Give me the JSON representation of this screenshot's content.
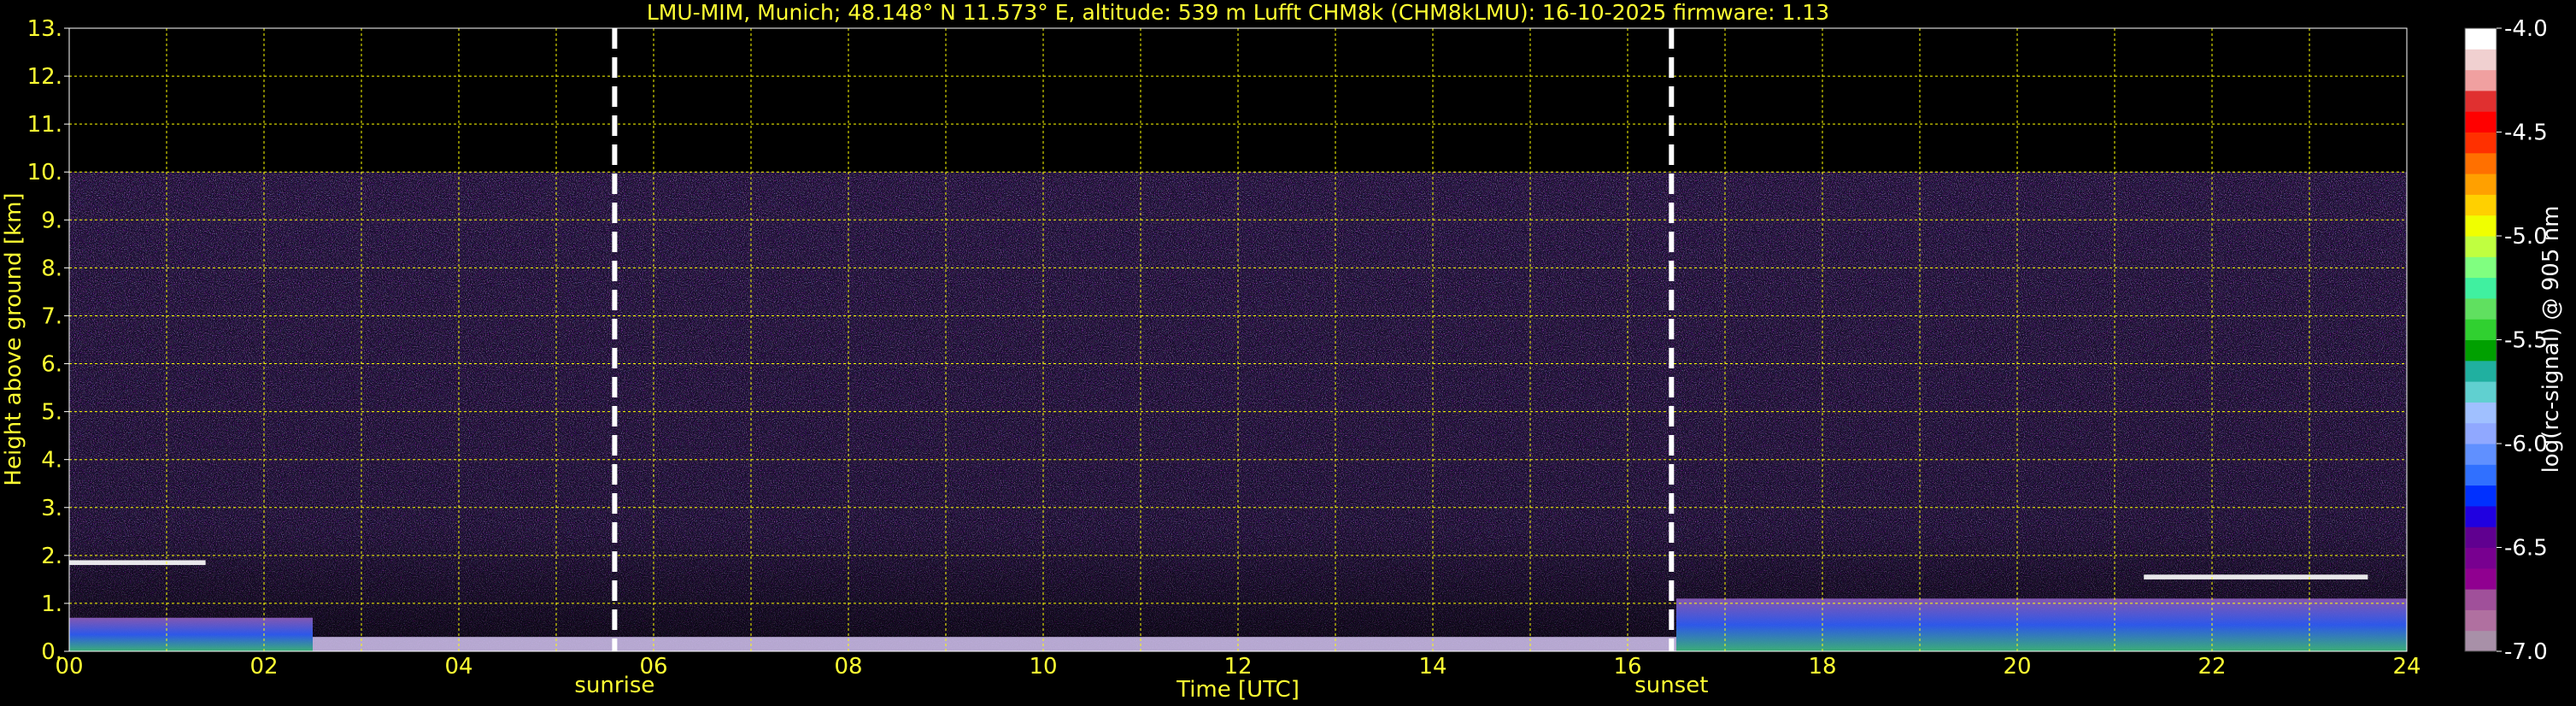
{
  "chart_data": {
    "type": "heatmap",
    "title": "LMU-MIM, Munich; 48.148° N 11.573° E, altitude: 539 m    Lufft CHM8k (CHM8kLMU): 16-10-2025    firmware: 1.13",
    "xlabel": "Time [UTC]",
    "ylabel": "Height above ground [km]",
    "xlim": [
      0,
      24
    ],
    "ylim": [
      0,
      13
    ],
    "x_ticks": [
      "00",
      "02",
      "04",
      "06",
      "08",
      "10",
      "12",
      "14",
      "16",
      "18",
      "20",
      "22",
      "24"
    ],
    "y_ticks": [
      "0.",
      "1.",
      "2.",
      "3.",
      "4.",
      "5.",
      "6.",
      "7.",
      "8.",
      "9.",
      "10.",
      "11.",
      "12.",
      "13."
    ],
    "grid": true,
    "grid_color": "#ffff00",
    "events": [
      {
        "name": "sunrise",
        "time": 5.6
      },
      {
        "name": "sunset",
        "time": 16.45
      }
    ],
    "colorbar": {
      "label": "log(rc-signal) @ 905 nm",
      "range": [
        -7.0,
        -4.0
      ],
      "ticks": [
        "-4.0",
        "-4.5",
        "-5.0",
        "-5.5",
        "-6.0",
        "-6.5",
        "-7.0"
      ],
      "colors": [
        "#a890a8",
        "#b070a0",
        "#a0509a",
        "#900090",
        "#780090",
        "#600090",
        "#2000e0",
        "#0030ff",
        "#3070ff",
        "#6090ff",
        "#90a8ff",
        "#a0c0ff",
        "#60d0d0",
        "#20b0a0",
        "#00a000",
        "#30d030",
        "#60e060",
        "#40f0a0",
        "#80ff80",
        "#c0ff40",
        "#f0ff00",
        "#ffd000",
        "#ffa000",
        "#ff7000",
        "#ff3000",
        "#ff0000",
        "#e03030",
        "#f0a0a0",
        "#f0d0d0",
        "#ffffff"
      ]
    },
    "signal_top_km": 10.0,
    "features": [
      {
        "type": "cloud",
        "x": [
          0,
          1.4
        ],
        "y": [
          1.8,
          1.9
        ]
      },
      {
        "type": "boundary_layer",
        "x": [
          0,
          2.5
        ],
        "y": [
          0,
          0.7
        ]
      },
      {
        "type": "surface_layer",
        "x": [
          2.5,
          16.5
        ],
        "y": [
          0,
          0.3
        ]
      },
      {
        "type": "boundary_layer",
        "x": [
          16.5,
          24
        ],
        "y": [
          0,
          1.1
        ]
      },
      {
        "type": "cloud",
        "x": [
          21.3,
          23.6
        ],
        "y": [
          1.5,
          1.6
        ]
      }
    ]
  }
}
